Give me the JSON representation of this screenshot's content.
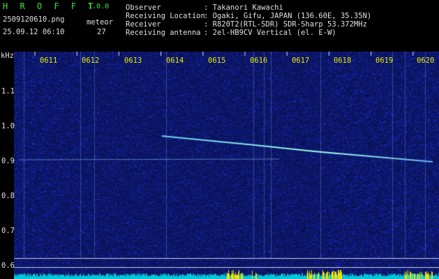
{
  "app": {
    "name": "H R O F F T",
    "version": "1.0.0"
  },
  "file": {
    "name": "2509120610.png",
    "datetime": "25.09.12 06:10"
  },
  "meteor": {
    "label": "meteor",
    "count": "27"
  },
  "info": [
    {
      "label": "Observer",
      "value": ": Takanori Kawachi"
    },
    {
      "label": "Receiving Location",
      "value": ": Ogaki, Gifu, JAPAN (136.60E, 35.35N)"
    },
    {
      "label": "Receiver",
      "value": ": R820T2(RTL-SDR) SDR-Sharp 53.372MHz"
    },
    {
      "label": "Receiving antenna",
      "value": ": 2el-HB9CV Vertical (el. E-W)"
    }
  ],
  "axis": {
    "unit": "kHz",
    "y_ticks": [
      "1.1",
      "1.0",
      "0.9",
      "0.8",
      "0.7",
      "0.6"
    ],
    "time_labels": [
      "0611",
      "0612",
      "0613",
      "0614",
      "0615",
      "0616",
      "0617",
      "0618",
      "0619",
      "0620"
    ]
  },
  "colors": {
    "bg_noise": "#0c1a78",
    "trace": "#7fe6ff",
    "bottom_strip": "#00ccdd",
    "yellow_spikes": "#f0e000"
  }
}
